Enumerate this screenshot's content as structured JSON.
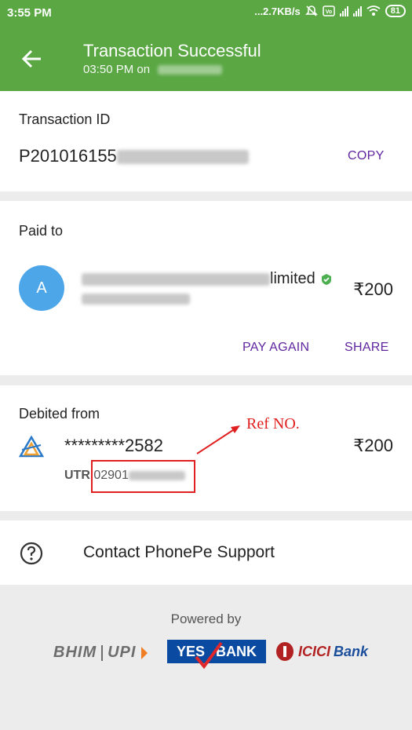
{
  "status_bar": {
    "time": "3:55 PM",
    "net_speed": "...2.7KB/s",
    "battery": "81"
  },
  "header": {
    "title": "Transaction Successful",
    "subtitle": "03:50 PM on"
  },
  "transaction": {
    "label": "Transaction ID",
    "id": "P201016155",
    "copy_label": "COPY"
  },
  "paid_to": {
    "label": "Paid to",
    "avatar_letter": "A",
    "name_suffix": "limited",
    "amount": "₹200",
    "pay_again_label": "PAY AGAIN",
    "share_label": "SHARE"
  },
  "debited_from": {
    "label": "Debited from",
    "account": "*********2582",
    "amount": "₹200",
    "utr_label": "UTR",
    "utr_value": "02901"
  },
  "annotation": {
    "ref_label": "Ref NO.",
    "color": "#e02020"
  },
  "support": {
    "label": "Contact PhonePe Support"
  },
  "footer": {
    "powered_by": "Powered by",
    "logos": {
      "bhim": "BHIM",
      "upi": "UPI",
      "yes_bank_left": "YES",
      "yes_bank_right": "BANK",
      "icici_left": "ICICI",
      "icici_right": "Bank"
    }
  },
  "colors": {
    "header_green": "#5aa744",
    "action_purple": "#5f259f",
    "avatar_blue": "#4ca6e8",
    "verified_green": "#4caf50"
  }
}
